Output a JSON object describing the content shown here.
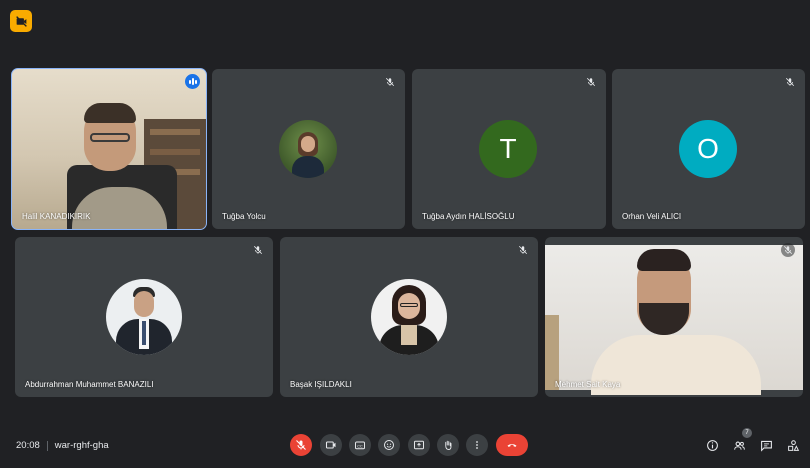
{
  "participants": [
    {
      "name": "Halil KANADIKIRIK",
      "speaking": true
    },
    {
      "name": "Tuğba Yolcu",
      "muted": true
    },
    {
      "name": "Tuğba Aydın HALİSOĞLU",
      "muted": true,
      "avatar_letter": "T",
      "avatar_color": "#33691e"
    },
    {
      "name": "Orhan Veli ALICI",
      "muted": true,
      "avatar_letter": "O",
      "avatar_color": "#00acc1"
    },
    {
      "name": "Abdurrahman Muhammet BANAZILI",
      "muted": true
    },
    {
      "name": "Başak IŞILDAKLI",
      "muted": true
    },
    {
      "name": "Mehmet Sait Kaya",
      "muted": true
    }
  ],
  "meeting": {
    "time": "20:08",
    "code": "war-rghf-gha"
  },
  "participant_count": "7",
  "colors": {
    "background": "#202124",
    "tile": "#3c4043",
    "danger": "#ea4335",
    "accent": "#8ab4f8"
  },
  "controls": [
    "mic-off-icon",
    "camera-icon",
    "captions-icon",
    "emoji-icon",
    "present-icon",
    "raise-hand-icon",
    "more-icon",
    "hangup-icon"
  ],
  "right_controls": [
    "info-icon",
    "people-icon",
    "chat-icon",
    "activities-icon"
  ]
}
